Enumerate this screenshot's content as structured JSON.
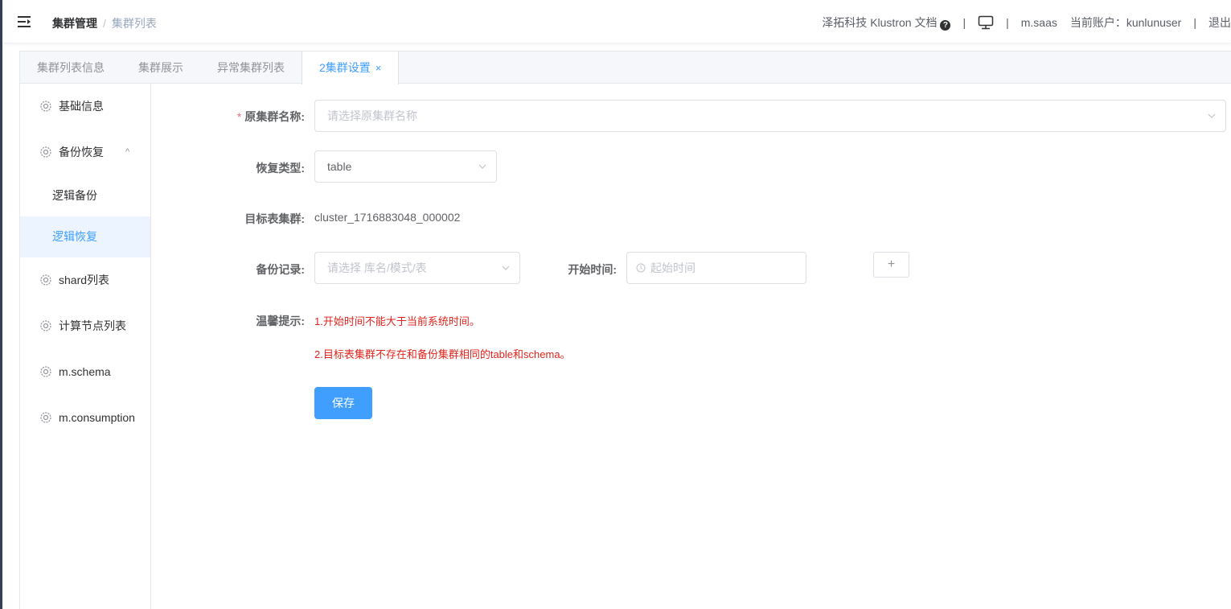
{
  "header": {
    "breadcrumb_root": "集群管理",
    "breadcrumb_sep": "/",
    "breadcrumb_current": "集群列表",
    "brand_text": "泽拓科技 Klustron 文档",
    "help_icon_char": "?",
    "separator": "|",
    "saas_link": "m.saas",
    "account_label": "当前账户：",
    "account_name": "kunlunuser",
    "logout": "退出"
  },
  "tabs": [
    {
      "label": "集群列表信息"
    },
    {
      "label": "集群展示"
    },
    {
      "label": "异常集群列表"
    },
    {
      "label": "2集群设置",
      "close": "×"
    }
  ],
  "sidebar": {
    "basic_info": "基础信息",
    "backup_restore": "备份恢复",
    "logical_backup": "逻辑备份",
    "logical_restore": "逻辑恢复",
    "shard_list": "shard列表",
    "compute_nodes": "计算节点列表",
    "m_schema": "m.schema",
    "m_consumption": "m.consumption",
    "expand_arrow": "^"
  },
  "form": {
    "source_cluster_label": "原集群名称:",
    "required_mark": "*",
    "source_cluster_placeholder": "请选择原集群名称",
    "restore_type_label": "恢复类型:",
    "restore_type_value": "table",
    "target_cluster_label": "目标表集群:",
    "target_cluster_value": "cluster_1716883048_000002",
    "backup_record_label": "备份记录:",
    "backup_record_placeholder": "请选择 库名/模式/表",
    "start_time_label": "开始时间:",
    "start_time_placeholder": "起始时间",
    "add_button": "+",
    "tips_label": "温馨提示:",
    "tip1": "1.开始时间不能大于当前系统时间。",
    "tip2": "2.目标表集群不存在和备份集群相同的table和schema。",
    "save_button": "保存"
  },
  "colors": {
    "primary": "#409eff",
    "danger": "#e0251c",
    "active_bg": "#ecf5ff"
  }
}
